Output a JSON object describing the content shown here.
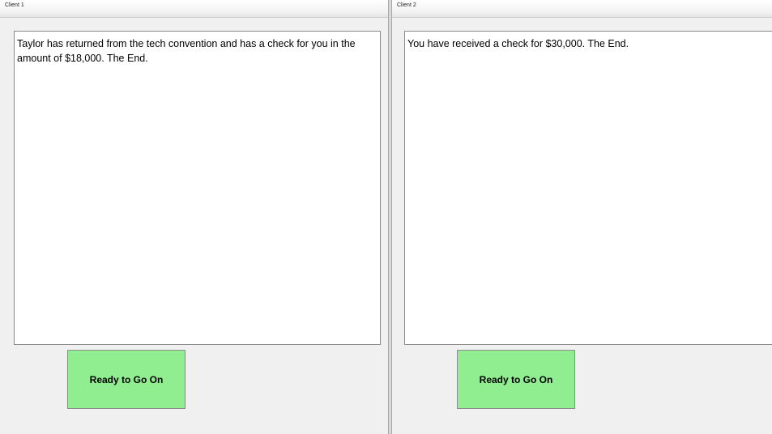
{
  "clients": [
    {
      "title": "Client 1",
      "message": "Taylor has returned from the tech convention and has a check for you in the amount of $18,000. The End.",
      "button_label": "Ready to Go On"
    },
    {
      "title": "Client 2",
      "message": "You have received a check for $30,000. The End.",
      "button_label": "Ready to Go On"
    }
  ],
  "colors": {
    "button_background": "#90ee90",
    "pane_background": "#f0f0f0",
    "text_area_background": "#ffffff"
  }
}
